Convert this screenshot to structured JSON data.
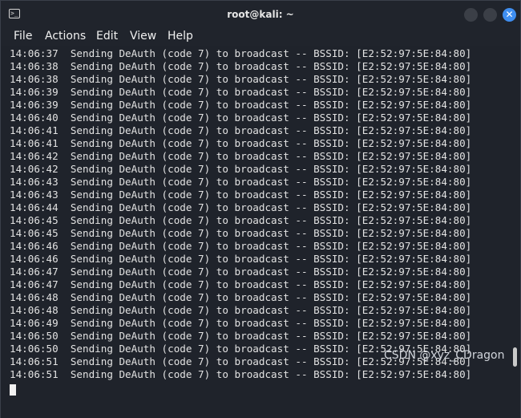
{
  "window": {
    "title": "root@kali: ~",
    "close_glyph": "✕",
    "app_icon_glyph": ">_",
    "accent_color": "#3f8ef0"
  },
  "menu": {
    "items": [
      "File",
      "Actions",
      "Edit",
      "View",
      "Help"
    ]
  },
  "terminal": {
    "lines": [
      "14:06:37  Sending DeAuth (code 7) to broadcast -- BSSID: [E2:52:97:5E:84:80]",
      "14:06:38  Sending DeAuth (code 7) to broadcast -- BSSID: [E2:52:97:5E:84:80]",
      "14:06:38  Sending DeAuth (code 7) to broadcast -- BSSID: [E2:52:97:5E:84:80]",
      "14:06:39  Sending DeAuth (code 7) to broadcast -- BSSID: [E2:52:97:5E:84:80]",
      "14:06:39  Sending DeAuth (code 7) to broadcast -- BSSID: [E2:52:97:5E:84:80]",
      "14:06:40  Sending DeAuth (code 7) to broadcast -- BSSID: [E2:52:97:5E:84:80]",
      "14:06:41  Sending DeAuth (code 7) to broadcast -- BSSID: [E2:52:97:5E:84:80]",
      "14:06:41  Sending DeAuth (code 7) to broadcast -- BSSID: [E2:52:97:5E:84:80]",
      "14:06:42  Sending DeAuth (code 7) to broadcast -- BSSID: [E2:52:97:5E:84:80]",
      "14:06:42  Sending DeAuth (code 7) to broadcast -- BSSID: [E2:52:97:5E:84:80]",
      "14:06:43  Sending DeAuth (code 7) to broadcast -- BSSID: [E2:52:97:5E:84:80]",
      "14:06:43  Sending DeAuth (code 7) to broadcast -- BSSID: [E2:52:97:5E:84:80]",
      "14:06:44  Sending DeAuth (code 7) to broadcast -- BSSID: [E2:52:97:5E:84:80]",
      "14:06:45  Sending DeAuth (code 7) to broadcast -- BSSID: [E2:52:97:5E:84:80]",
      "14:06:45  Sending DeAuth (code 7) to broadcast -- BSSID: [E2:52:97:5E:84:80]",
      "14:06:46  Sending DeAuth (code 7) to broadcast -- BSSID: [E2:52:97:5E:84:80]",
      "14:06:46  Sending DeAuth (code 7) to broadcast -- BSSID: [E2:52:97:5E:84:80]",
      "14:06:47  Sending DeAuth (code 7) to broadcast -- BSSID: [E2:52:97:5E:84:80]",
      "14:06:47  Sending DeAuth (code 7) to broadcast -- BSSID: [E2:52:97:5E:84:80]",
      "14:06:48  Sending DeAuth (code 7) to broadcast -- BSSID: [E2:52:97:5E:84:80]",
      "14:06:48  Sending DeAuth (code 7) to broadcast -- BSSID: [E2:52:97:5E:84:80]",
      "14:06:49  Sending DeAuth (code 7) to broadcast -- BSSID: [E2:52:97:5E:84:80]",
      "14:06:50  Sending DeAuth (code 7) to broadcast -- BSSID: [E2:52:97:5E:84:80]",
      "14:06:50  Sending DeAuth (code 7) to broadcast -- BSSID: [E2:52:97:5E:84:80]",
      "14:06:51  Sending DeAuth (code 7) to broadcast -- BSSID: [E2:52:97:5E:84:80]",
      "14:06:51  Sending DeAuth (code 7) to broadcast -- BSSID: [E2:52:97:5E:84:80]"
    ]
  },
  "watermark": "CSDN @xyz_CDragon"
}
